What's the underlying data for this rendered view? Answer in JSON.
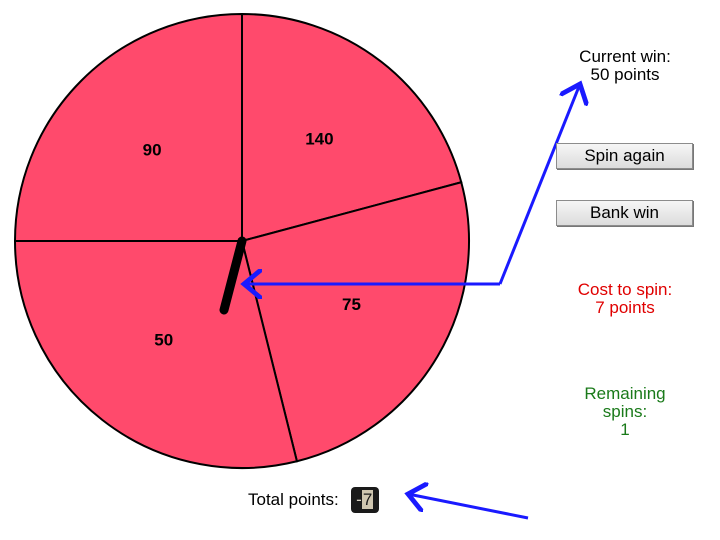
{
  "wheel": {
    "segments": [
      {
        "label": "90",
        "start_deg": 180,
        "end_deg": 270,
        "color": "#ff4a6c"
      },
      {
        "label": "140",
        "start_deg": 270,
        "end_deg": 345,
        "color": "#ff4a6c"
      },
      {
        "label": "75",
        "start_deg": 345,
        "end_deg": 76,
        "color": "#ff4a6c"
      },
      {
        "label": "50",
        "start_deg": 76,
        "end_deg": 180,
        "color": "#ff4a6c"
      }
    ],
    "pointer_color": "#000000"
  },
  "current_win": {
    "line1": "Current win:",
    "line2": "50 points"
  },
  "buttons": {
    "spin_again": "Spin again",
    "bank_win": "Bank win"
  },
  "cost": {
    "line1": "Cost to spin:",
    "line2": "7 points",
    "color": "#e00000"
  },
  "remaining": {
    "line1": "Remaining",
    "line2": "spins:",
    "line3": "1",
    "color": "#1a7a1a"
  },
  "total": {
    "label": "Total points:",
    "sign": "-",
    "value": "7"
  },
  "annotation_color": "#1a1aff"
}
